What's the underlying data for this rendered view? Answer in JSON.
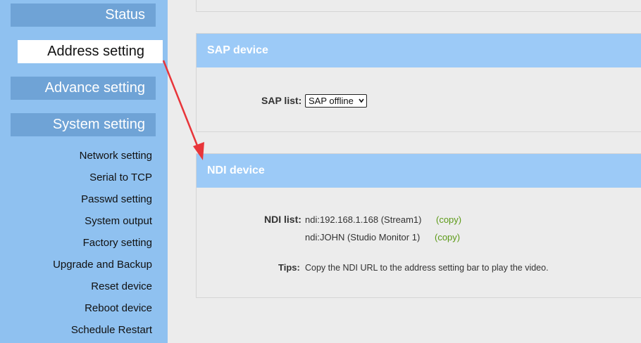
{
  "sidebar": {
    "menu": [
      {
        "label": "Status"
      },
      {
        "label": "Address setting"
      },
      {
        "label": "Advance setting"
      },
      {
        "label": "System setting"
      }
    ],
    "sub_items": [
      {
        "label": "Network setting"
      },
      {
        "label": "Serial to TCP"
      },
      {
        "label": "Passwd setting"
      },
      {
        "label": "System output"
      },
      {
        "label": "Factory setting"
      },
      {
        "label": "Upgrade and Backup"
      },
      {
        "label": "Reset device"
      },
      {
        "label": "Reboot device"
      },
      {
        "label": "Schedule Restart"
      }
    ]
  },
  "sap": {
    "title": "SAP device",
    "list_label": "SAP list:",
    "selected": "SAP offline"
  },
  "ndi": {
    "title": "NDI device",
    "list_label": "NDI list:",
    "entries": [
      {
        "url": "ndi:192.168.1.168 (Stream1)",
        "copy": "(copy)"
      },
      {
        "url": "ndi:JOHN (Studio Monitor 1)",
        "copy": "(copy)"
      }
    ],
    "tips_label": "Tips:",
    "tips_text": "Copy the NDI URL to the address setting bar to play the video."
  },
  "colors": {
    "sidebar_bg": "#8fc1f0",
    "menu_button": "#6fa3d6",
    "panel_header": "#9ccaf7",
    "copy_link": "#5c9a17",
    "annotation_arrow": "#e8353a"
  }
}
